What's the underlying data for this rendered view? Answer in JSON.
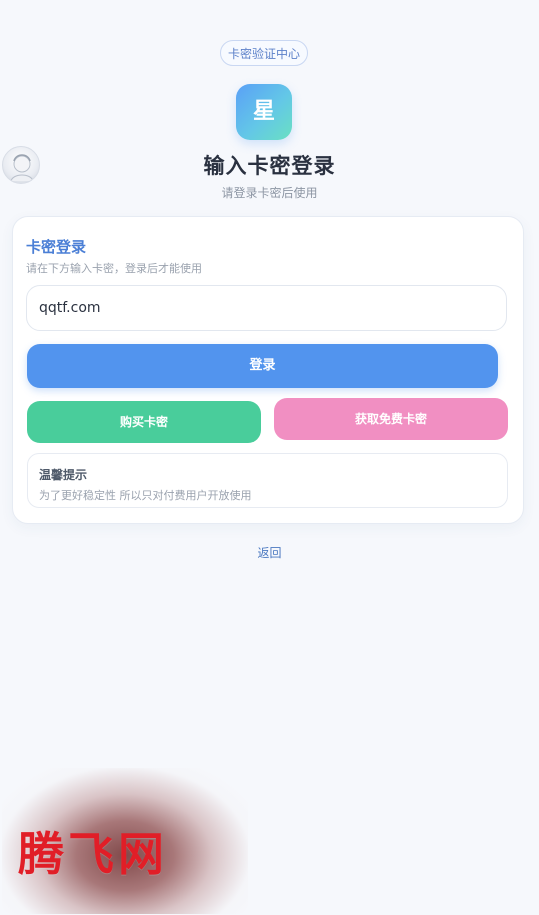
{
  "header": {
    "badge": "卡密验证中心",
    "logo_char": "星",
    "title": "输入卡密登录",
    "subtitle": "请登录卡密后使用"
  },
  "card": {
    "title": "卡密登录",
    "description": "请在下方输入卡密，登录后才能使用",
    "input_value": "qqtf.com",
    "login_button": "登录",
    "buy_button": "购买卡密",
    "free_button": "获取免费卡密",
    "notice": {
      "title": "温馨提示",
      "text": "为了更好稳定性 所以只对付费用户开放使用"
    }
  },
  "back_link": "返回",
  "watermark": "腾飞网",
  "colors": {
    "accent_blue": "#5294ee",
    "accent_green": "#49cd9b",
    "accent_pink": "#f18fc2",
    "title_blue": "#4b7fd6",
    "background": "#f6f8fc"
  },
  "icons": {
    "avatar": "user-avatar"
  }
}
